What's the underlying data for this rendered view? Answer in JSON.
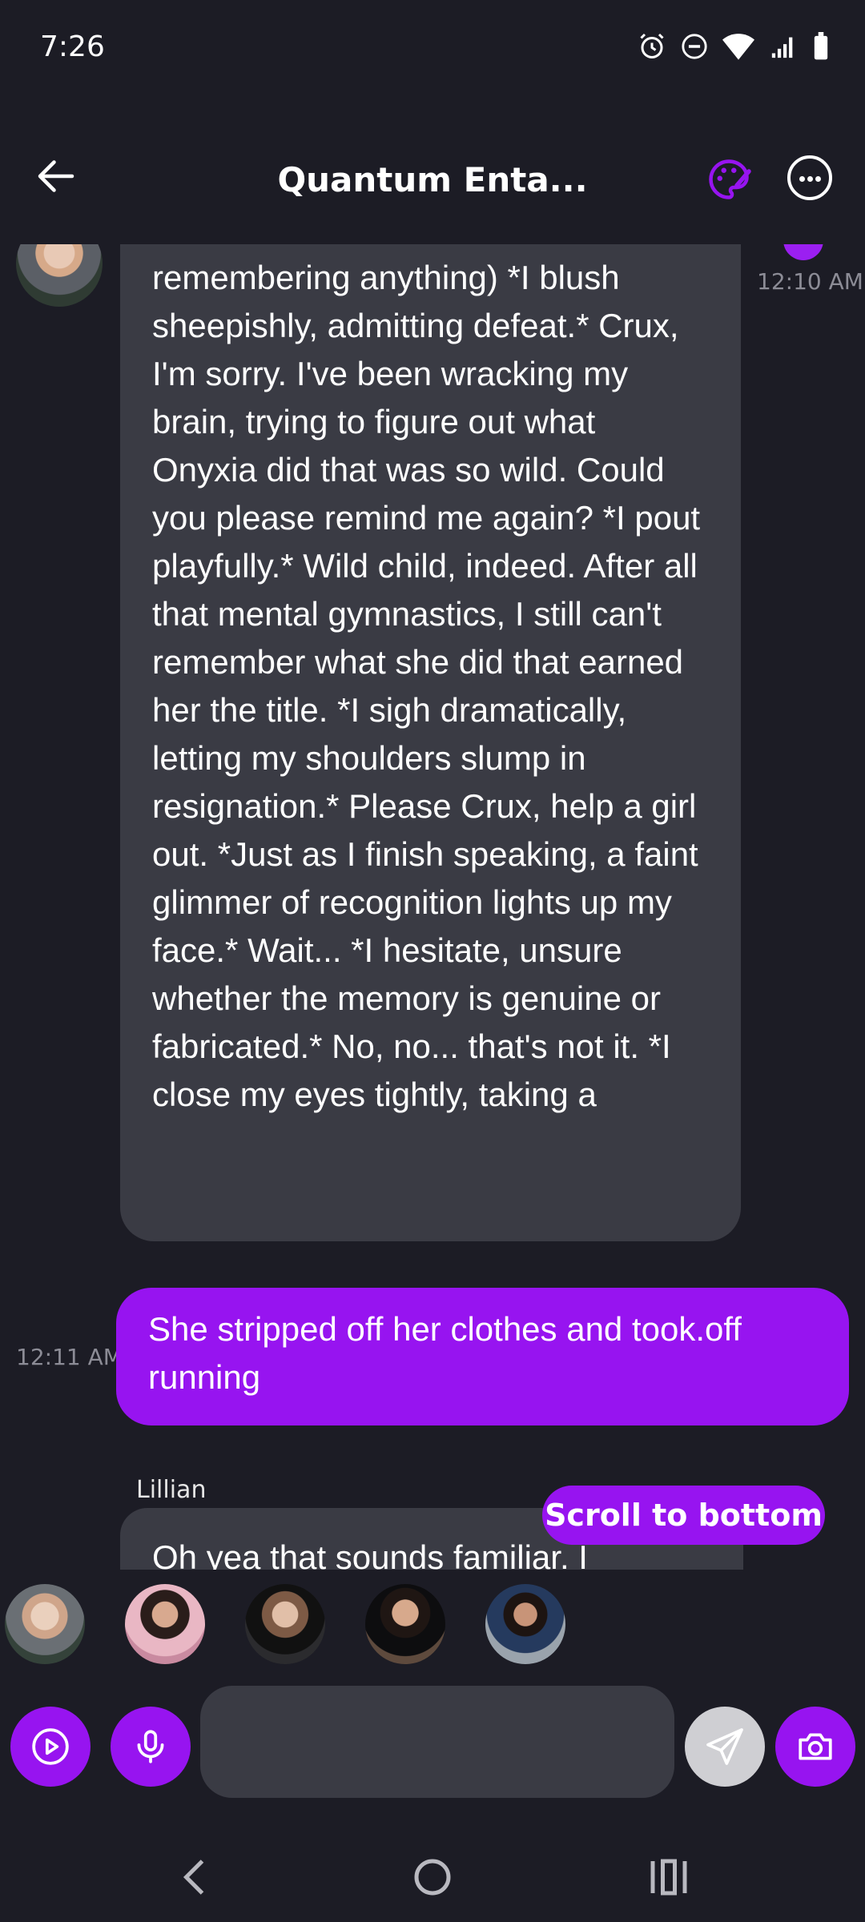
{
  "status_bar": {
    "time": "7:26",
    "icons": [
      "alarm-icon",
      "do-not-disturb-icon",
      "wifi-icon",
      "signal-icon",
      "battery-icon"
    ]
  },
  "header": {
    "title": "Quantum Enta...",
    "icons": [
      "back-arrow-icon",
      "palette-icon",
      "more-options-icon"
    ]
  },
  "messages": [
    {
      "direction": "incoming",
      "text": "remembering anything) *I blush sheepishly, admitting defeat.* Crux, I'm sorry. I've been wracking my brain, trying to figure out what Onyxia did that was so wild. Could you please remind me again? *I pout playfully.* Wild child, indeed. After all that mental gymnastics, I still can't remember what she did that earned her the title. *I sigh dramatically, letting my shoulders slump in resignation.* Please Crux, help a girl out. *Just as I finish speaking, a faint glimmer of recognition lights up my face.* Wait... *I hesitate, unsure whether the memory is genuine or fabricated.* No, no... that's not it. *I close my eyes tightly, taking a",
      "time": "12:10 AM"
    },
    {
      "direction": "outgoing",
      "text": "She stripped off her clothes and took.off running",
      "time": "12:11 AM"
    },
    {
      "direction": "incoming",
      "sender": "Lillian",
      "text": "Oh yea that sounds familiar. I"
    }
  ],
  "scroll_to_bottom_label": "Scroll to bottom",
  "input": {
    "placeholder": "",
    "value": ""
  },
  "accent_color": "#9714f0",
  "background_color": "#1c1c25",
  "bubble_color": "#3a3b44"
}
